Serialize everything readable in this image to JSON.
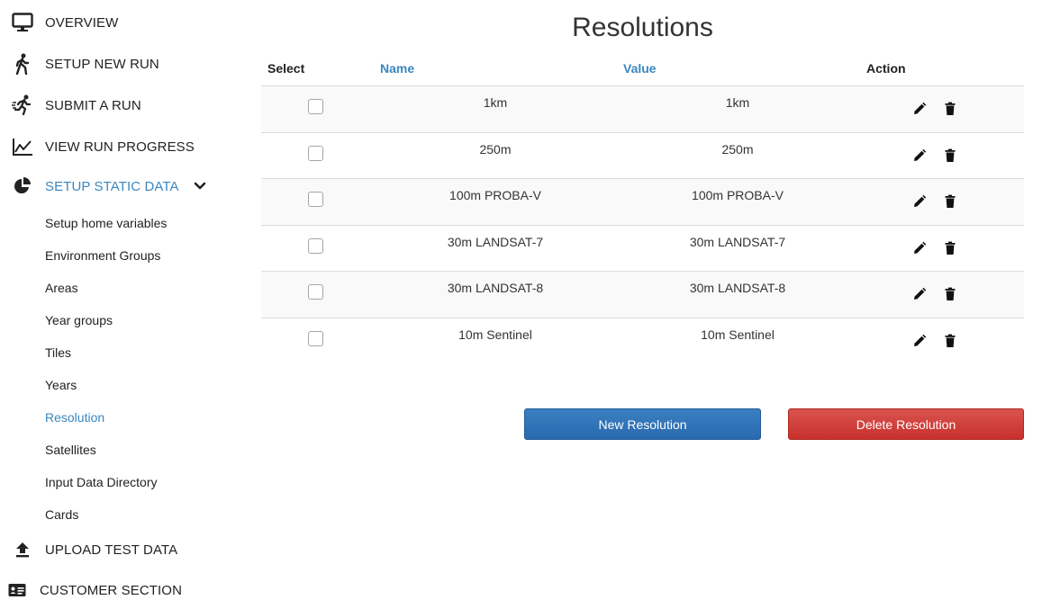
{
  "sidebar": {
    "items": [
      {
        "label": "OVERVIEW",
        "icon": "monitor-icon"
      },
      {
        "label": "SETUP NEW RUN",
        "icon": "walking-person-icon"
      },
      {
        "label": "SUBMIT A RUN",
        "icon": "running-person-icon"
      },
      {
        "label": "VIEW RUN PROGRESS",
        "icon": "line-chart-icon"
      },
      {
        "label": "SETUP STATIC DATA",
        "icon": "pie-chart-icon",
        "active": true,
        "expanded": true
      },
      {
        "label": "UPLOAD TEST DATA",
        "icon": "upload-icon"
      },
      {
        "label": "CUSTOMER SECTION",
        "icon": "id-card-icon"
      }
    ],
    "subitems": [
      "Setup home variables",
      "Environment Groups",
      "Areas",
      "Year groups",
      "Tiles",
      "Years",
      "Resolution",
      "Satellites",
      "Input Data Directory",
      "Cards"
    ],
    "active_subitem": "Resolution"
  },
  "main": {
    "title": "Resolutions",
    "columns": {
      "select": "Select",
      "name": "Name",
      "value": "Value",
      "action": "Action"
    },
    "rows": [
      {
        "name": "1km",
        "value": "1km",
        "checked": false
      },
      {
        "name": "250m",
        "value": "250m",
        "checked": false
      },
      {
        "name": "100m PROBA-V",
        "value": "100m PROBA-V",
        "checked": false
      },
      {
        "name": "30m LANDSAT-7",
        "value": "30m LANDSAT-7",
        "checked": false
      },
      {
        "name": "30m LANDSAT-8",
        "value": "30m LANDSAT-8",
        "checked": false
      },
      {
        "name": "10m Sentinel",
        "value": "10m Sentinel",
        "checked": false
      }
    ],
    "buttons": {
      "new_label": "New Resolution",
      "delete_label": "Delete Resolution"
    }
  },
  "colors": {
    "accent": "#3a87c0",
    "primary_button": "#2f72b6",
    "danger_button": "#d0403b",
    "row_stripe": "#f9f9f9"
  }
}
